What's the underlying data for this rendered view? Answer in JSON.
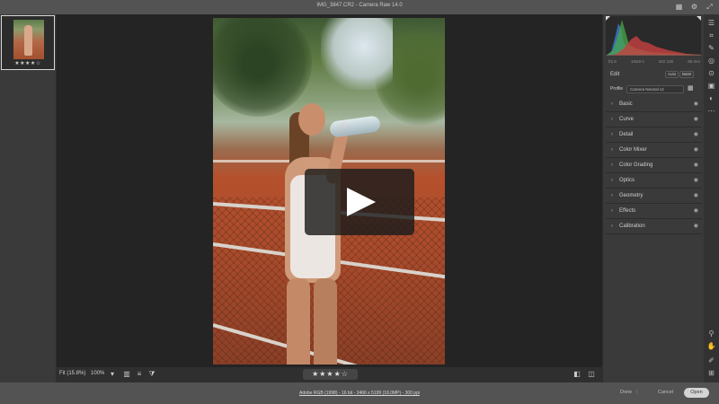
{
  "app": {
    "title": "IMG_3847.CR2 - Camera Raw 14.0"
  },
  "titlebar_icons": [
    "grid-icon",
    "gear-icon",
    "expand-icon"
  ],
  "filmstrip": {
    "items": [
      {
        "rating": "★★★★☆"
      }
    ]
  },
  "canvas": {
    "fit_label": "Fit (15.8%)",
    "zoom": "100%",
    "rating": "★★★★☆",
    "play_overlay": true
  },
  "panel": {
    "histogram_values": [
      "f/2.8",
      "1/640 s",
      "ISO 100",
      "85 mm"
    ],
    "edit_label": "Edit",
    "auto_label": "Auto",
    "bw_label": "B&W",
    "profile_label": "Profile",
    "profile_value": "Camera Neutral v2",
    "sections": [
      "Basic",
      "Curve",
      "Detail",
      "Color Mixer",
      "Color Grading",
      "Optics",
      "Geometry",
      "Effects",
      "Calibration"
    ]
  },
  "footer": {
    "info": "Adobe RGB (1998) - 16 bit - 3466 x 5199 (18.0MP) - 300 ppi",
    "done": "Done",
    "cancel": "Cancel",
    "open": "Open"
  },
  "colors": {
    "accent": "#d4d4d4",
    "histogram_blue": "#3a76c8",
    "histogram_green": "#4aa84a",
    "histogram_red": "#c84040"
  }
}
